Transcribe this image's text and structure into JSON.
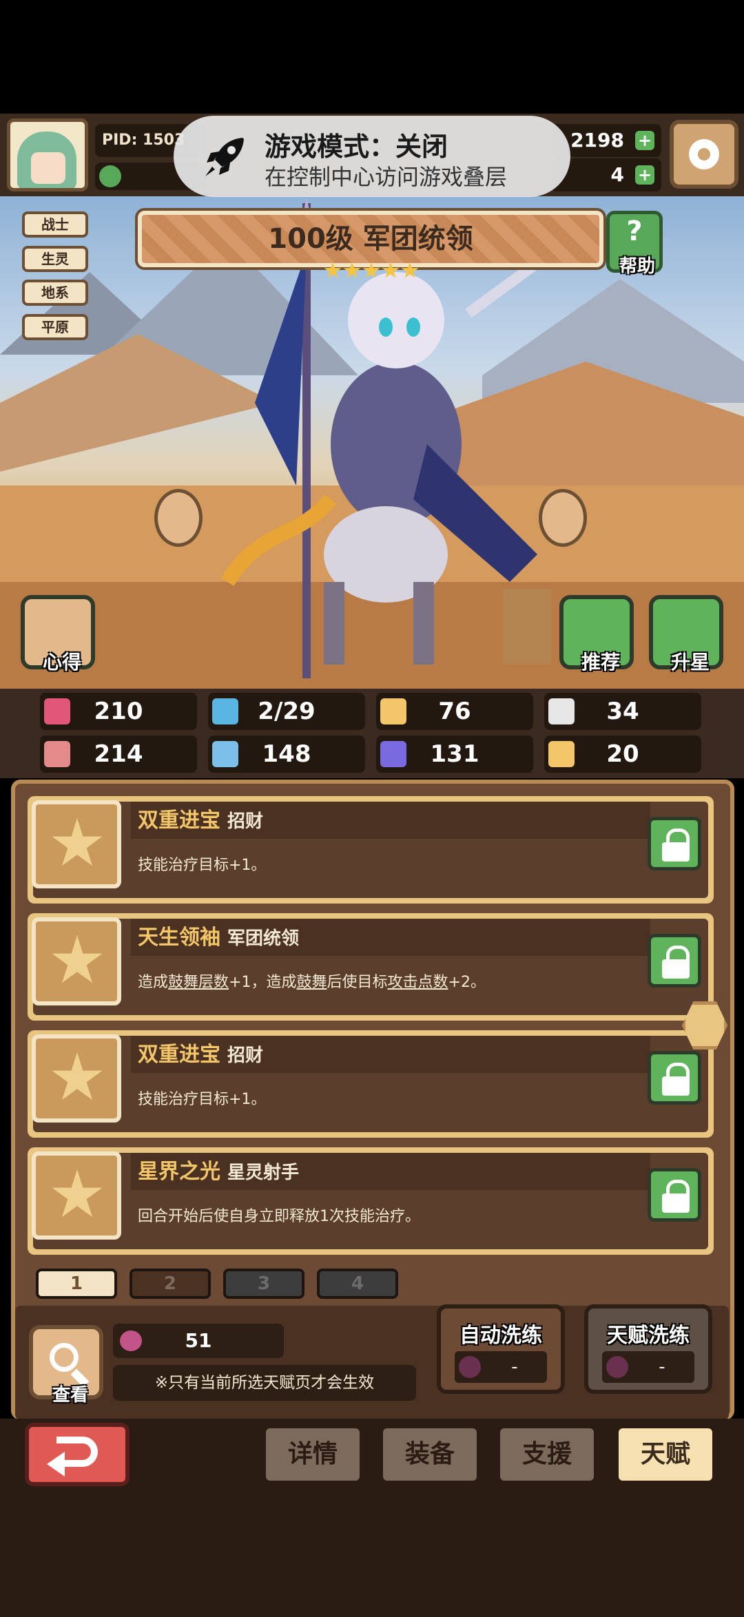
{
  "topbar": {
    "pid": "PID: 1503",
    "gold": "2198",
    "gems": "4"
  },
  "overlay": {
    "title": "游戏模式：关闭",
    "subtitle": "在控制中心访问游戏叠层"
  },
  "hero": {
    "tags": [
      "战士",
      "生灵",
      "地系",
      "平原"
    ],
    "title": "100级 军团统领",
    "star_count": 5,
    "help_label": "帮助",
    "insight_label": "心得",
    "recommend_label": "推荐",
    "upgrade_star_label": "升星"
  },
  "stats": {
    "row1": [
      "210",
      "2/29",
      "76",
      "34"
    ],
    "row2": [
      "214",
      "148",
      "131",
      "20"
    ]
  },
  "talents": [
    {
      "name": "双重进宝",
      "sub": "招财",
      "desc": "技能治疗目标+1。"
    },
    {
      "name": "天生领袖",
      "sub": "军团统领",
      "desc_parts": [
        "造成",
        "鼓舞层数",
        "+1，造成",
        "鼓舞",
        "后使目标",
        "攻击点数",
        "+2。"
      ]
    },
    {
      "name": "双重进宝",
      "sub": "招财",
      "desc": "技能治疗目标+1。"
    },
    {
      "name": "星界之光",
      "sub": "星灵射手",
      "desc": "回合开始后使自身立即释放1次技能治疗。"
    }
  ],
  "pages": [
    "1",
    "2",
    "3",
    "4"
  ],
  "lower": {
    "view_label": "查看",
    "fruit_count": "51",
    "notice": "※只有当前所选天赋页才会生效",
    "auto_wash": {
      "label": "自动洗练",
      "value": "-"
    },
    "talent_wash": {
      "label": "天赋洗练",
      "value": "-"
    }
  },
  "nav": {
    "details": "详情",
    "equip": "装备",
    "support": "支援",
    "talent": "天赋"
  },
  "colors": {
    "accent_gold": "#f4c66a",
    "lock_green": "#5fb35a",
    "back_red": "#e05a55"
  }
}
